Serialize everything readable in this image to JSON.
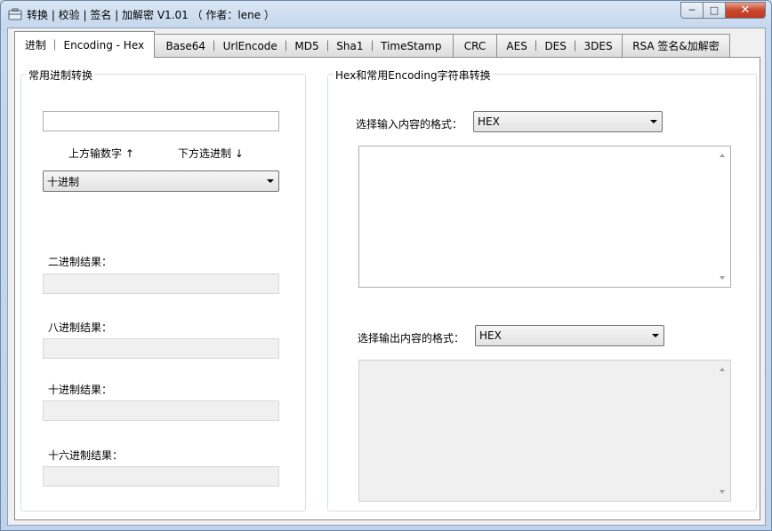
{
  "window": {
    "title": "转换 | 校验 | 签名 | 加解密 V1.01 （ 作者：lene ）",
    "min_glyph": "─",
    "max_glyph": "□",
    "close_glyph": "✕"
  },
  "tabs": [
    {
      "label": "进制 ｜ Encoding - Hex",
      "active": true
    },
    {
      "label": "Base64 ｜ UrlEncode ｜ MD5 ｜ Sha1 ｜ TimeStamp",
      "active": false
    },
    {
      "label": "CRC",
      "active": false
    },
    {
      "label": "AES ｜ DES ｜ 3DES",
      "active": false
    },
    {
      "label": "RSA 签名&加解密",
      "active": false
    }
  ],
  "left_group": {
    "title": "常用进制转换",
    "input_value": "",
    "hint_number": "上方输数字 ↑",
    "hint_base": "下方选进制 ↓",
    "base_select": "十进制",
    "binary_label": "二进制结果：",
    "binary_value": "",
    "octal_label": "八进制结果：",
    "octal_value": "",
    "decimal_label": "十进制结果：",
    "decimal_value": "",
    "hex_label": "十六进制结果：",
    "hex_value": ""
  },
  "right_group": {
    "title": "Hex和常用Encoding字符串转换",
    "input_format_label": "选择输入内容的格式：",
    "input_format": "HEX",
    "input_text": "",
    "output_format_label": "选择输出内容的格式：",
    "output_format": "HEX",
    "output_text": ""
  }
}
